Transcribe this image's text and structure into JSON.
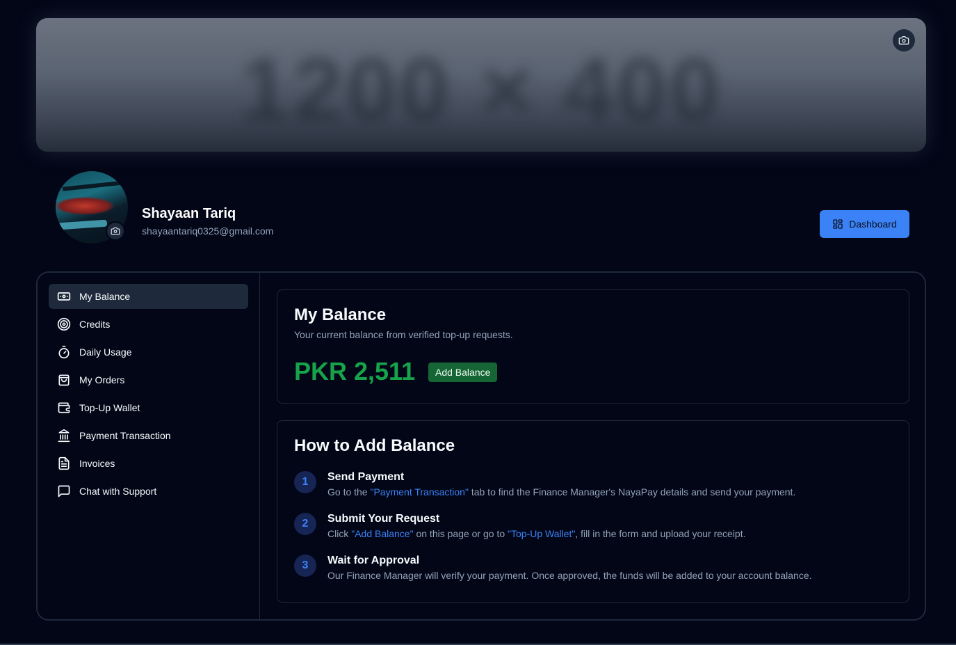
{
  "banner": {
    "placeholder_text": "1200 × 400"
  },
  "profile": {
    "name": "Shayaan Tariq",
    "email": "shayaantariq0325@gmail.com"
  },
  "header": {
    "dashboard_label": "Dashboard"
  },
  "sidebar": {
    "items": [
      {
        "label": "My Balance",
        "icon": "banknote-icon",
        "active": true
      },
      {
        "label": "Credits",
        "icon": "target-icon"
      },
      {
        "label": "Daily Usage",
        "icon": "timer-icon"
      },
      {
        "label": "My Orders",
        "icon": "shopping-bag-icon"
      },
      {
        "label": "Top-Up Wallet",
        "icon": "wallet-icon"
      },
      {
        "label": "Payment Transaction",
        "icon": "bank-icon"
      },
      {
        "label": "Invoices",
        "icon": "file-text-icon"
      },
      {
        "label": "Chat with Support",
        "icon": "message-square-icon"
      }
    ]
  },
  "balance": {
    "title": "My Balance",
    "description": "Your current balance from verified top-up requests.",
    "amount": "PKR 2,511",
    "add_label": "Add Balance"
  },
  "howto": {
    "title": "How to Add Balance",
    "steps": [
      {
        "number": "1",
        "title": "Send Payment",
        "desc_parts": [
          "Go to the ",
          "\"Payment Transaction\"",
          " tab to find the Finance Manager's NayaPay details and send your payment."
        ]
      },
      {
        "number": "2",
        "title": "Submit Your Request",
        "desc_parts": [
          "Click ",
          "\"Add Balance\"",
          " on this page or go to ",
          "\"Top-Up Wallet\"",
          ", fill in the form and upload your receipt."
        ]
      },
      {
        "number": "3",
        "title": "Wait for Approval",
        "desc_parts": [
          "Our Finance Manager will verify your payment. Once approved, the funds will be added to your account balance."
        ]
      }
    ]
  },
  "colors": {
    "background": "#020617",
    "accent": "#3b82f6",
    "success": "#16a34a",
    "border": "#1e293b"
  }
}
